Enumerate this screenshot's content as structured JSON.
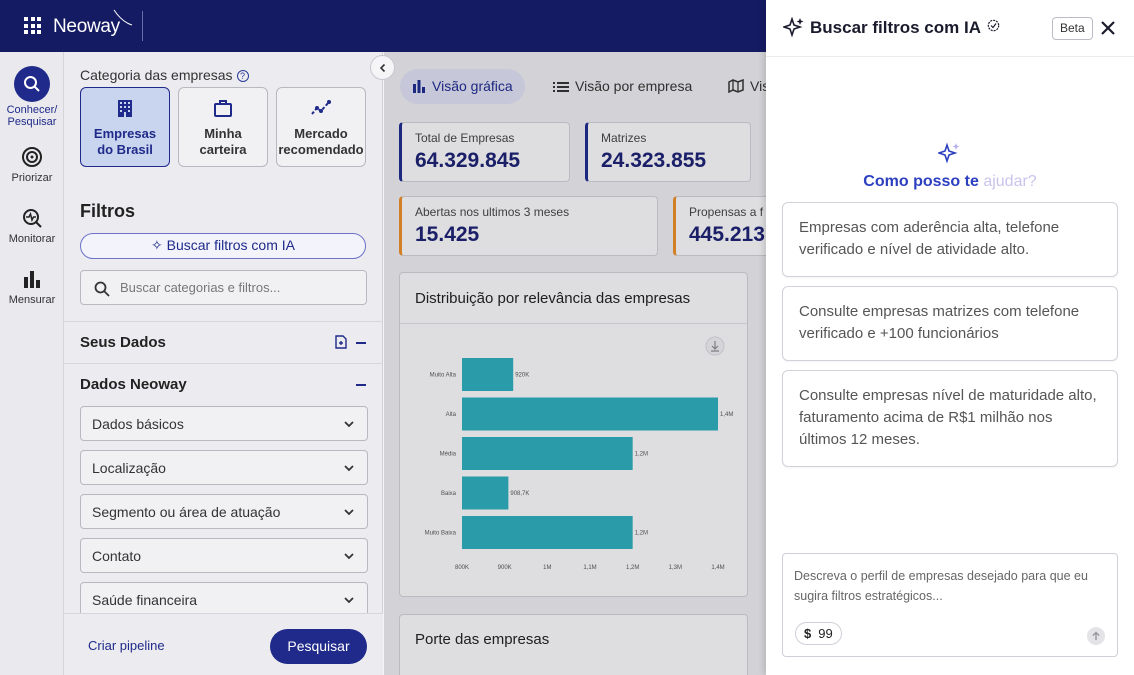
{
  "topbar": {
    "brand": "Neoway"
  },
  "rail": {
    "items": [
      {
        "label_line1": "Conhecer/",
        "label_line2": "Pesquisar",
        "icon": "search-icon",
        "active": true
      },
      {
        "label": "Priorizar",
        "icon": "target-icon"
      },
      {
        "label": "Monitorar",
        "icon": "monitor-icon"
      },
      {
        "label": "Mensurar",
        "icon": "bar-chart-icon"
      }
    ]
  },
  "filters": {
    "category_title": "Categoria das empresas",
    "category_help": "?",
    "categories": [
      {
        "line1": "Empresas",
        "line2": "do Brasil",
        "icon": "building-icon",
        "selected": true
      },
      {
        "line1": "Minha",
        "line2": "carteira",
        "icon": "briefcase-icon"
      },
      {
        "line1": "Mercado",
        "line2": "recomendado",
        "icon": "trend-icon"
      }
    ],
    "title": "Filtros",
    "ai_button": "Buscar filtros com IA",
    "search_placeholder": "Buscar categorias e filtros...",
    "sections": {
      "seus_dados": "Seus Dados",
      "dados_neoway": "Dados Neoway"
    },
    "dropdowns": [
      "Dados básicos",
      "Localização",
      "Segmento ou área de atuação",
      "Contato",
      "Saúde financeira"
    ],
    "create_pipeline": "Criar pipeline",
    "search_button": "Pesquisar"
  },
  "main": {
    "tabs": [
      {
        "label": "Visão gráfica",
        "icon": "bar-chart-icon",
        "active": true
      },
      {
        "label": "Visão por empresa",
        "icon": "list-icon"
      },
      {
        "label": "Vis",
        "icon": "map-icon"
      }
    ],
    "kpis": [
      {
        "label": "Total de Empresas",
        "value": "64.329.845",
        "accent": "#1f2a8a"
      },
      {
        "label": "Matrizes",
        "value": "24.323.855",
        "accent": "#1f2a8a"
      },
      {
        "label": "Abertas nos ultimos 3 meses",
        "value": "15.425",
        "accent": "#e28a2b"
      },
      {
        "label": "Propensas a f",
        "value": "445.213",
        "accent": "#e28a2b"
      }
    ],
    "chart_title": "Distribuição por relevância das empresas",
    "porte_title": "Porte das empresas"
  },
  "chart_data": {
    "type": "bar",
    "orientation": "horizontal",
    "title": "Distribuição por relevância das empresas",
    "categories": [
      "Muito Alta",
      "Alta",
      "Média",
      "Baixa",
      "Muito Baixa"
    ],
    "values": [
      920000,
      1400000,
      1200000,
      908700,
      1200000
    ],
    "data_labels": [
      "920K",
      "1,4M",
      "1,2M",
      "908,7K",
      "1,2M"
    ],
    "xticks": [
      "800K",
      "900K",
      "1M",
      "1,1M",
      "1,2M",
      "1,3M",
      "1,4M"
    ],
    "xlim": [
      800000,
      1400000
    ],
    "bar_color": "#2ea7b5",
    "grid": false
  },
  "drawer": {
    "title": "Buscar filtros com IA",
    "beta": "Beta",
    "hero_prefix": "Como posso te ",
    "hero_suffix": "ajudar?",
    "suggestions": [
      "Empresas com aderência alta, telefone verificado e nível de atividade alto.",
      "Consulte empresas matrizes com telefone verificado e +100 funcionários",
      "Consulte empresas nível de maturidade alto, faturamento acima de R$1 milhão nos últimos 12 meses."
    ],
    "prompt_placeholder": "Descreva o perfil de empresas desejado para que eu sugira filtros estratégicos...",
    "credit_symbol": "$",
    "credits": "99",
    "accent": "#2b3fc0"
  }
}
